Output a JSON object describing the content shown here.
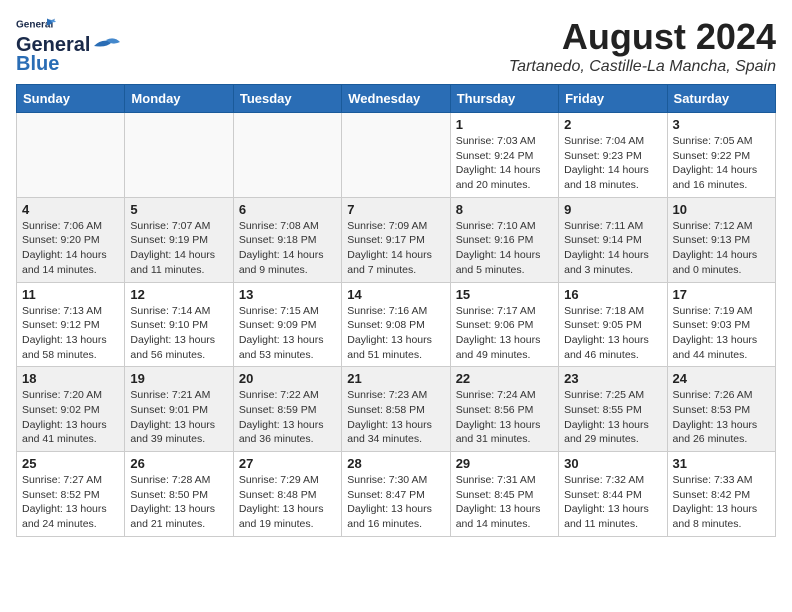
{
  "logo": {
    "line1": "General",
    "line2": "Blue"
  },
  "title": {
    "month_year": "August 2024",
    "location": "Tartanedo, Castille-La Mancha, Spain"
  },
  "days_of_week": [
    "Sunday",
    "Monday",
    "Tuesday",
    "Wednesday",
    "Thursday",
    "Friday",
    "Saturday"
  ],
  "weeks": [
    [
      {
        "day": "",
        "info": ""
      },
      {
        "day": "",
        "info": ""
      },
      {
        "day": "",
        "info": ""
      },
      {
        "day": "",
        "info": ""
      },
      {
        "day": "1",
        "info": "Sunrise: 7:03 AM\nSunset: 9:24 PM\nDaylight: 14 hours\nand 20 minutes."
      },
      {
        "day": "2",
        "info": "Sunrise: 7:04 AM\nSunset: 9:23 PM\nDaylight: 14 hours\nand 18 minutes."
      },
      {
        "day": "3",
        "info": "Sunrise: 7:05 AM\nSunset: 9:22 PM\nDaylight: 14 hours\nand 16 minutes."
      }
    ],
    [
      {
        "day": "4",
        "info": "Sunrise: 7:06 AM\nSunset: 9:20 PM\nDaylight: 14 hours\nand 14 minutes."
      },
      {
        "day": "5",
        "info": "Sunrise: 7:07 AM\nSunset: 9:19 PM\nDaylight: 14 hours\nand 11 minutes."
      },
      {
        "day": "6",
        "info": "Sunrise: 7:08 AM\nSunset: 9:18 PM\nDaylight: 14 hours\nand 9 minutes."
      },
      {
        "day": "7",
        "info": "Sunrise: 7:09 AM\nSunset: 9:17 PM\nDaylight: 14 hours\nand 7 minutes."
      },
      {
        "day": "8",
        "info": "Sunrise: 7:10 AM\nSunset: 9:16 PM\nDaylight: 14 hours\nand 5 minutes."
      },
      {
        "day": "9",
        "info": "Sunrise: 7:11 AM\nSunset: 9:14 PM\nDaylight: 14 hours\nand 3 minutes."
      },
      {
        "day": "10",
        "info": "Sunrise: 7:12 AM\nSunset: 9:13 PM\nDaylight: 14 hours\nand 0 minutes."
      }
    ],
    [
      {
        "day": "11",
        "info": "Sunrise: 7:13 AM\nSunset: 9:12 PM\nDaylight: 13 hours\nand 58 minutes."
      },
      {
        "day": "12",
        "info": "Sunrise: 7:14 AM\nSunset: 9:10 PM\nDaylight: 13 hours\nand 56 minutes."
      },
      {
        "day": "13",
        "info": "Sunrise: 7:15 AM\nSunset: 9:09 PM\nDaylight: 13 hours\nand 53 minutes."
      },
      {
        "day": "14",
        "info": "Sunrise: 7:16 AM\nSunset: 9:08 PM\nDaylight: 13 hours\nand 51 minutes."
      },
      {
        "day": "15",
        "info": "Sunrise: 7:17 AM\nSunset: 9:06 PM\nDaylight: 13 hours\nand 49 minutes."
      },
      {
        "day": "16",
        "info": "Sunrise: 7:18 AM\nSunset: 9:05 PM\nDaylight: 13 hours\nand 46 minutes."
      },
      {
        "day": "17",
        "info": "Sunrise: 7:19 AM\nSunset: 9:03 PM\nDaylight: 13 hours\nand 44 minutes."
      }
    ],
    [
      {
        "day": "18",
        "info": "Sunrise: 7:20 AM\nSunset: 9:02 PM\nDaylight: 13 hours\nand 41 minutes."
      },
      {
        "day": "19",
        "info": "Sunrise: 7:21 AM\nSunset: 9:01 PM\nDaylight: 13 hours\nand 39 minutes."
      },
      {
        "day": "20",
        "info": "Sunrise: 7:22 AM\nSunset: 8:59 PM\nDaylight: 13 hours\nand 36 minutes."
      },
      {
        "day": "21",
        "info": "Sunrise: 7:23 AM\nSunset: 8:58 PM\nDaylight: 13 hours\nand 34 minutes."
      },
      {
        "day": "22",
        "info": "Sunrise: 7:24 AM\nSunset: 8:56 PM\nDaylight: 13 hours\nand 31 minutes."
      },
      {
        "day": "23",
        "info": "Sunrise: 7:25 AM\nSunset: 8:55 PM\nDaylight: 13 hours\nand 29 minutes."
      },
      {
        "day": "24",
        "info": "Sunrise: 7:26 AM\nSunset: 8:53 PM\nDaylight: 13 hours\nand 26 minutes."
      }
    ],
    [
      {
        "day": "25",
        "info": "Sunrise: 7:27 AM\nSunset: 8:52 PM\nDaylight: 13 hours\nand 24 minutes."
      },
      {
        "day": "26",
        "info": "Sunrise: 7:28 AM\nSunset: 8:50 PM\nDaylight: 13 hours\nand 21 minutes."
      },
      {
        "day": "27",
        "info": "Sunrise: 7:29 AM\nSunset: 8:48 PM\nDaylight: 13 hours\nand 19 minutes."
      },
      {
        "day": "28",
        "info": "Sunrise: 7:30 AM\nSunset: 8:47 PM\nDaylight: 13 hours\nand 16 minutes."
      },
      {
        "day": "29",
        "info": "Sunrise: 7:31 AM\nSunset: 8:45 PM\nDaylight: 13 hours\nand 14 minutes."
      },
      {
        "day": "30",
        "info": "Sunrise: 7:32 AM\nSunset: 8:44 PM\nDaylight: 13 hours\nand 11 minutes."
      },
      {
        "day": "31",
        "info": "Sunrise: 7:33 AM\nSunset: 8:42 PM\nDaylight: 13 hours\nand 8 minutes."
      }
    ]
  ]
}
